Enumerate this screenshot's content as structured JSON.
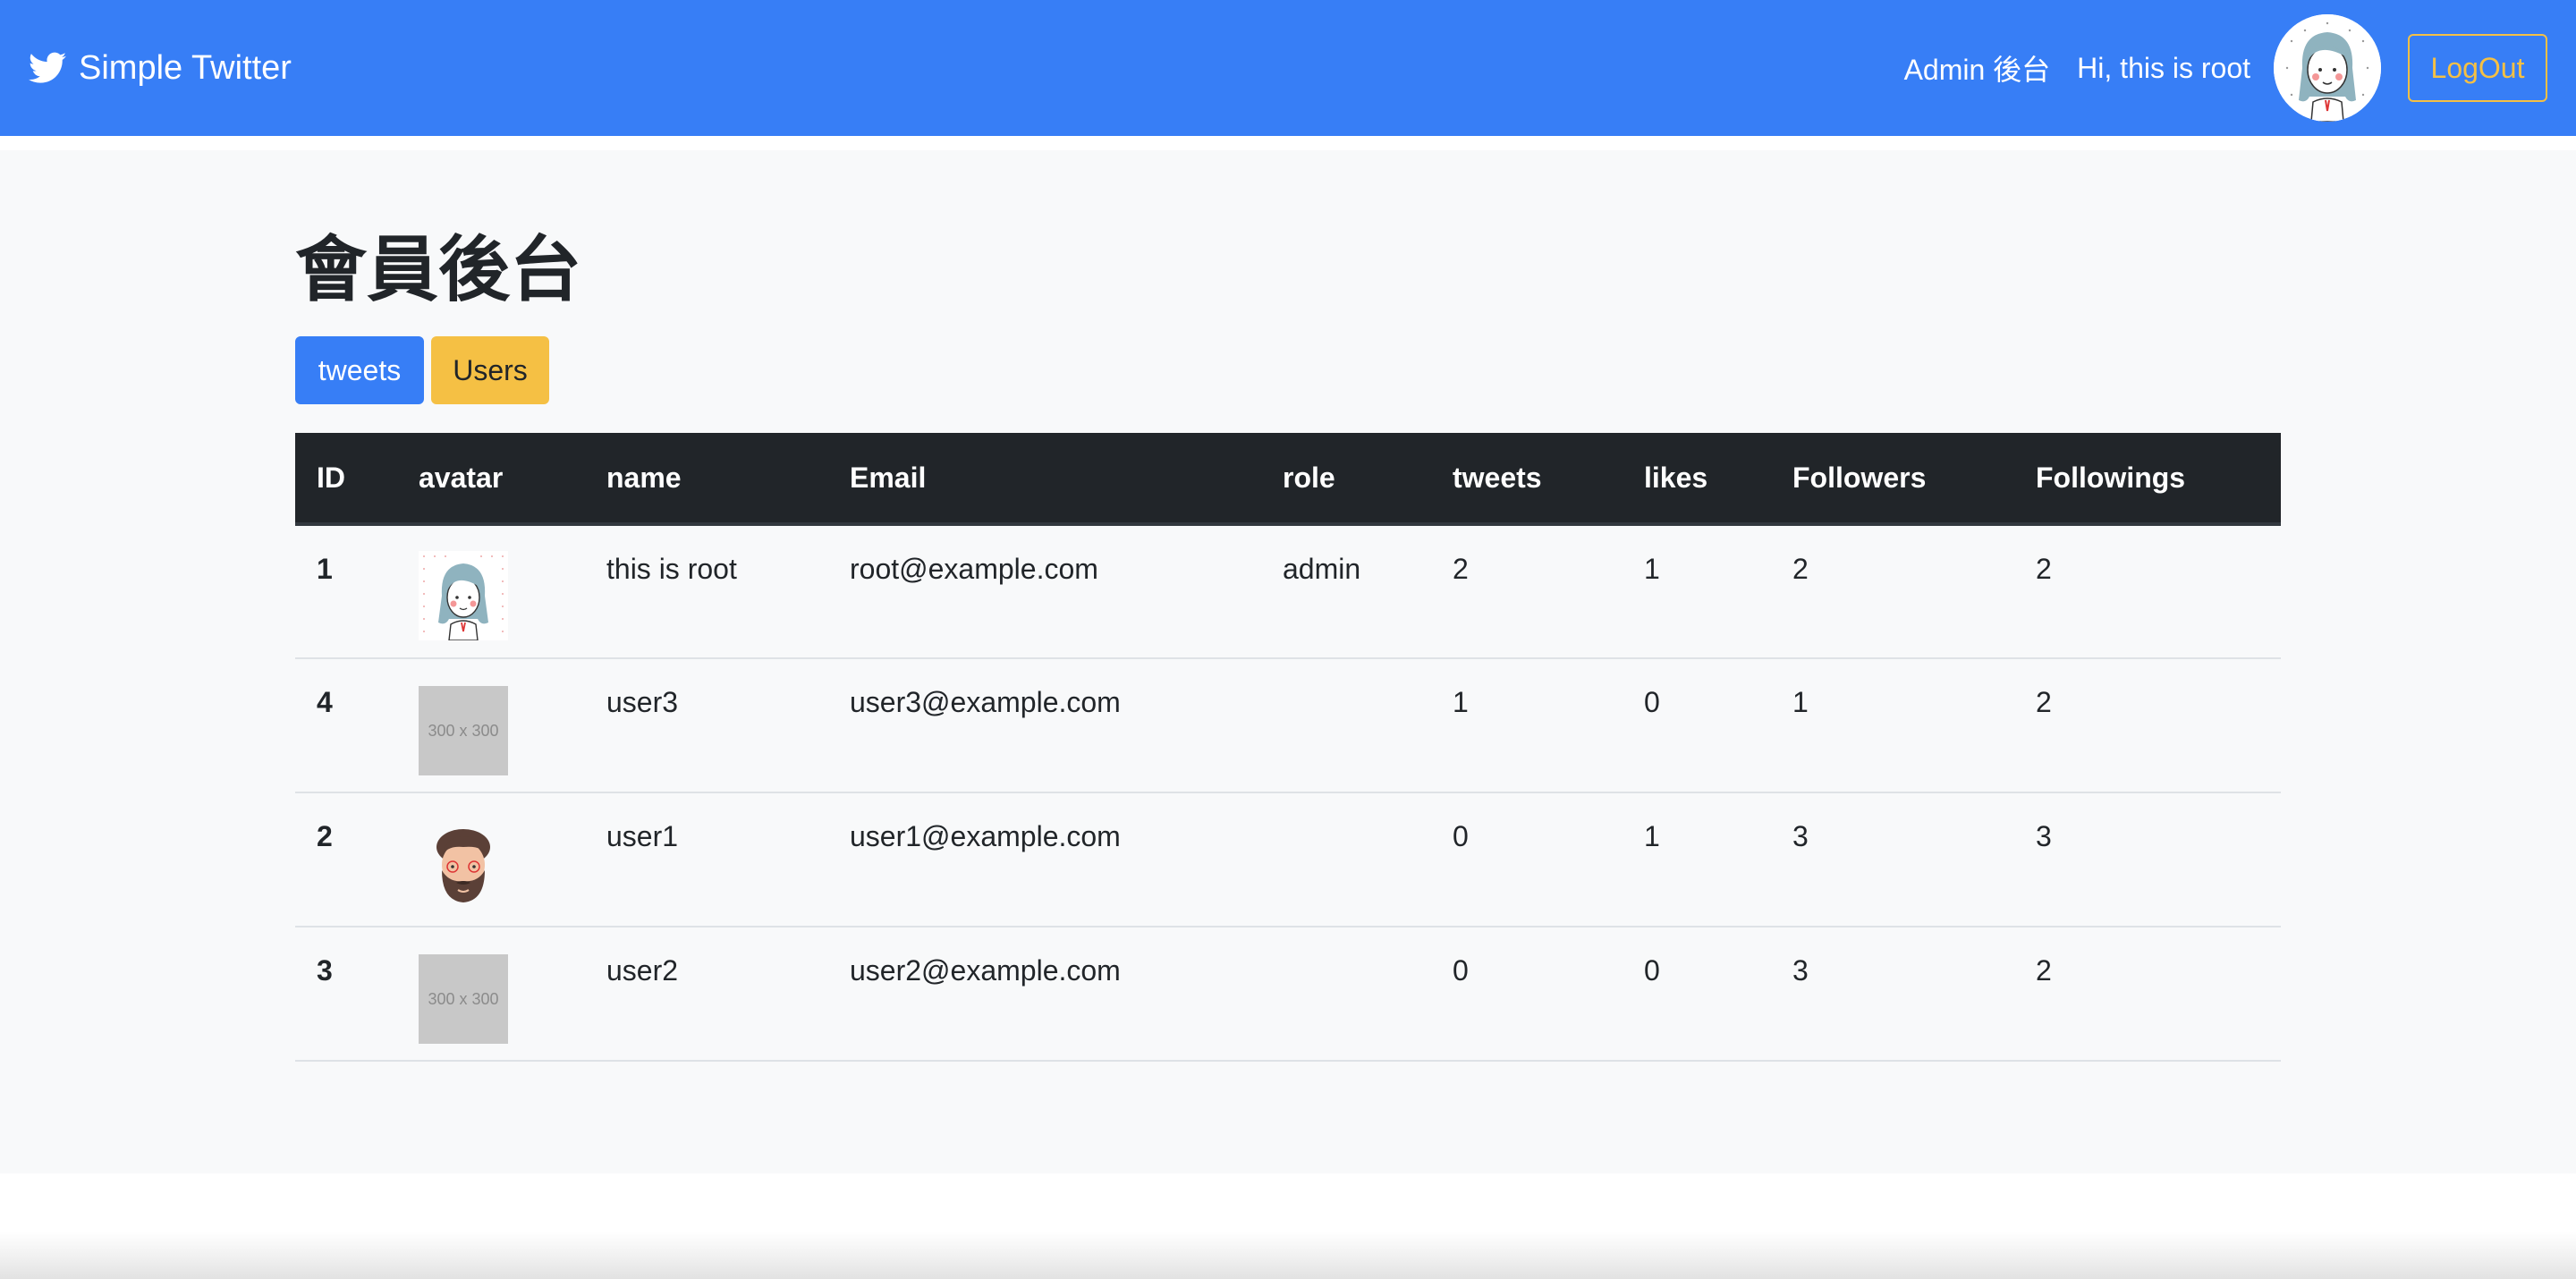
{
  "navbar": {
    "brand": "Simple Twitter",
    "admin_link": "Admin 後台",
    "greeting": "Hi, this is root",
    "logout_label": "LogOut"
  },
  "page": {
    "title": "會員後台",
    "tabs": [
      {
        "label": "tweets"
      },
      {
        "label": "Users"
      }
    ]
  },
  "table": {
    "headers": [
      "ID",
      "avatar",
      "name",
      "Email",
      "role",
      "tweets",
      "likes",
      "Followers",
      "Followings"
    ],
    "rows": [
      {
        "id": "1",
        "avatar": "girl-avatar",
        "name": "this is root",
        "email": "root@example.com",
        "role": "admin",
        "tweets": "2",
        "likes": "1",
        "followers": "2",
        "followings": "2"
      },
      {
        "id": "4",
        "avatar": "placeholder",
        "avatar_text": "300 x 300",
        "name": "user3",
        "email": "user3@example.com",
        "role": "",
        "tweets": "1",
        "likes": "0",
        "followers": "1",
        "followings": "2"
      },
      {
        "id": "2",
        "avatar": "bearded-man-avatar",
        "name": "user1",
        "email": "user1@example.com",
        "role": "",
        "tweets": "0",
        "likes": "1",
        "followers": "3",
        "followings": "3"
      },
      {
        "id": "3",
        "avatar": "placeholder",
        "avatar_text": "300 x 300",
        "name": "user2",
        "email": "user2@example.com",
        "role": "",
        "tweets": "0",
        "likes": "0",
        "followers": "3",
        "followings": "2"
      }
    ]
  },
  "colors": {
    "navbar": "#377ef6",
    "logout": "#f5c044",
    "table_header": "#212529",
    "tab_tweets": "#377ef6",
    "tab_users": "#f5c044"
  }
}
